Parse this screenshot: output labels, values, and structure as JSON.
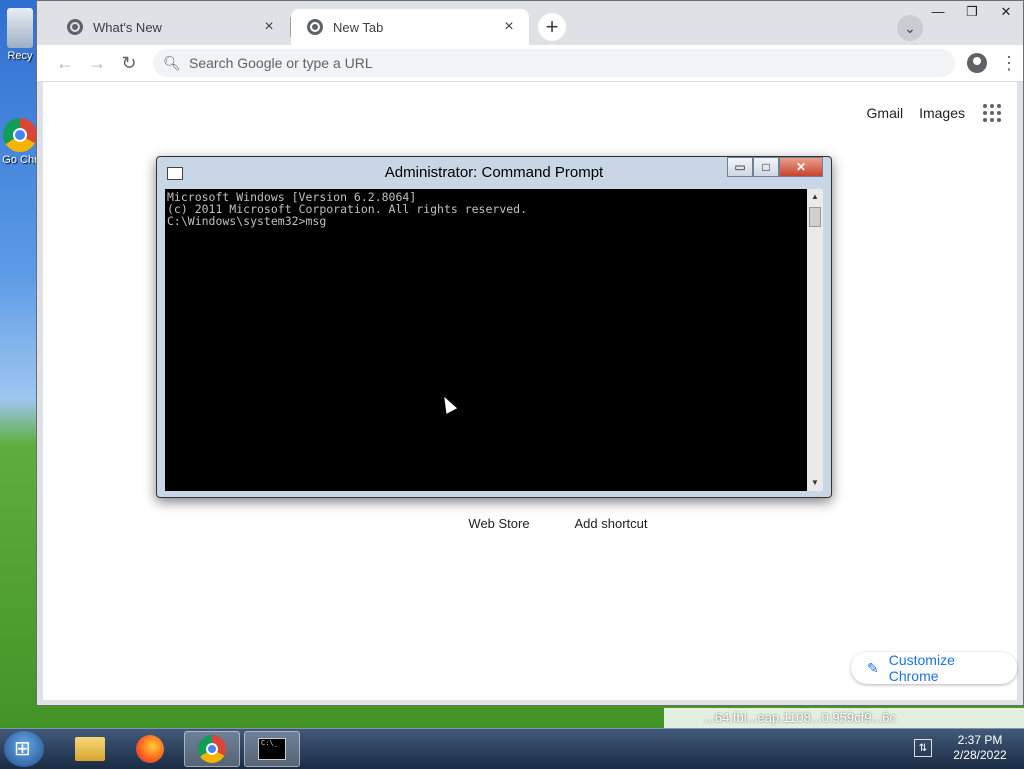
{
  "desktop": {
    "icons": [
      {
        "label": "Recy"
      },
      {
        "label": "Go Chr"
      }
    ]
  },
  "chrome": {
    "tabs": [
      {
        "label": "What's New",
        "active": false
      },
      {
        "label": "New Tab",
        "active": true
      }
    ],
    "new_tab_icon": "+",
    "tab_search_icon": "⌄",
    "window_controls": {
      "minimize": "—",
      "restore": "❐",
      "close": "✕"
    },
    "toolbar": {
      "back_icon": "←",
      "forward_icon": "→",
      "reload_icon": "↻",
      "omnibox_placeholder": "Search Google or type a URL",
      "menu_icon": "⋮"
    },
    "ntp": {
      "gmail": "Gmail",
      "images": "Images",
      "shortcuts": [
        "Web Store",
        "Add shortcut"
      ],
      "customize": "Customize Chrome",
      "customize_icon": "✎"
    }
  },
  "cmd": {
    "title": "Administrator: Command Prompt",
    "controls": {
      "minimize": "▭",
      "maximize": "□",
      "close": "✕"
    },
    "lines": [
      "Microsoft Windows [Version 6.2.8064]",
      "(c) 2011 Microsoft Corporation. All rights reserved.",
      "",
      "C:\\Windows\\system32>msg"
    ]
  },
  "notification_text": "...64.fbl...eap.1108...0.959cf9...6c",
  "taskbar": {
    "pinned": [
      "explorer-icon",
      "firefox-icon",
      "chrome-icon",
      "cmd-icon"
    ],
    "cmd_icon_text": "C:\\_",
    "clock": {
      "time": "2:37 PM",
      "date": "2/28/2022"
    }
  }
}
